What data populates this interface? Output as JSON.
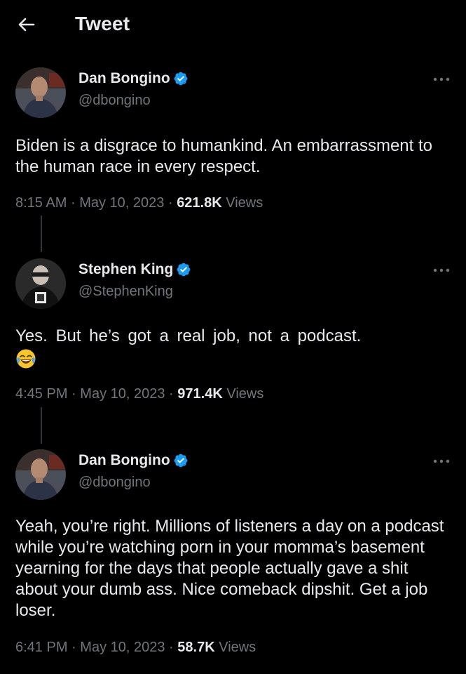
{
  "header": {
    "back_icon": "arrow-left-icon",
    "title": "Tweet"
  },
  "colors": {
    "background": "#000000",
    "text": "#e7e9ea",
    "secondary_text": "#71767b",
    "verified_badge": "#1d9bf0",
    "thread_line": "#333639"
  },
  "tweets": [
    {
      "author_name": "Dan Bongino",
      "handle": "@dbongino",
      "verified": true,
      "text": "Biden is a disgrace to humankind. An embarrassment to the human race in every respect.",
      "time": "8:15 AM",
      "date": "May 10, 2023",
      "views_count": "621.8K",
      "views_label": "Views",
      "separator": "·"
    },
    {
      "author_name": "Stephen King",
      "handle": "@StephenKing",
      "verified": true,
      "text": "Yes. But he’s got a real job, not a podcast.",
      "emoji": "face-with-tears-of-joy-icon",
      "time": "4:45 PM",
      "date": "May 10, 2023",
      "views_count": "971.4K",
      "views_label": "Views",
      "separator": "·"
    },
    {
      "author_name": "Dan Bongino",
      "handle": "@dbongino",
      "verified": true,
      "text": "Yeah, you’re right. Millions of listeners a day on a podcast while you’re watching porn in your momma’s basement yearning for the days that people actually gave a shit about your dumb ass. Nice comeback dipshit. Get a job loser.",
      "time": "6:41 PM",
      "date": "May 10, 2023",
      "views_count": "58.7K",
      "views_label": "Views",
      "separator": "·"
    }
  ]
}
